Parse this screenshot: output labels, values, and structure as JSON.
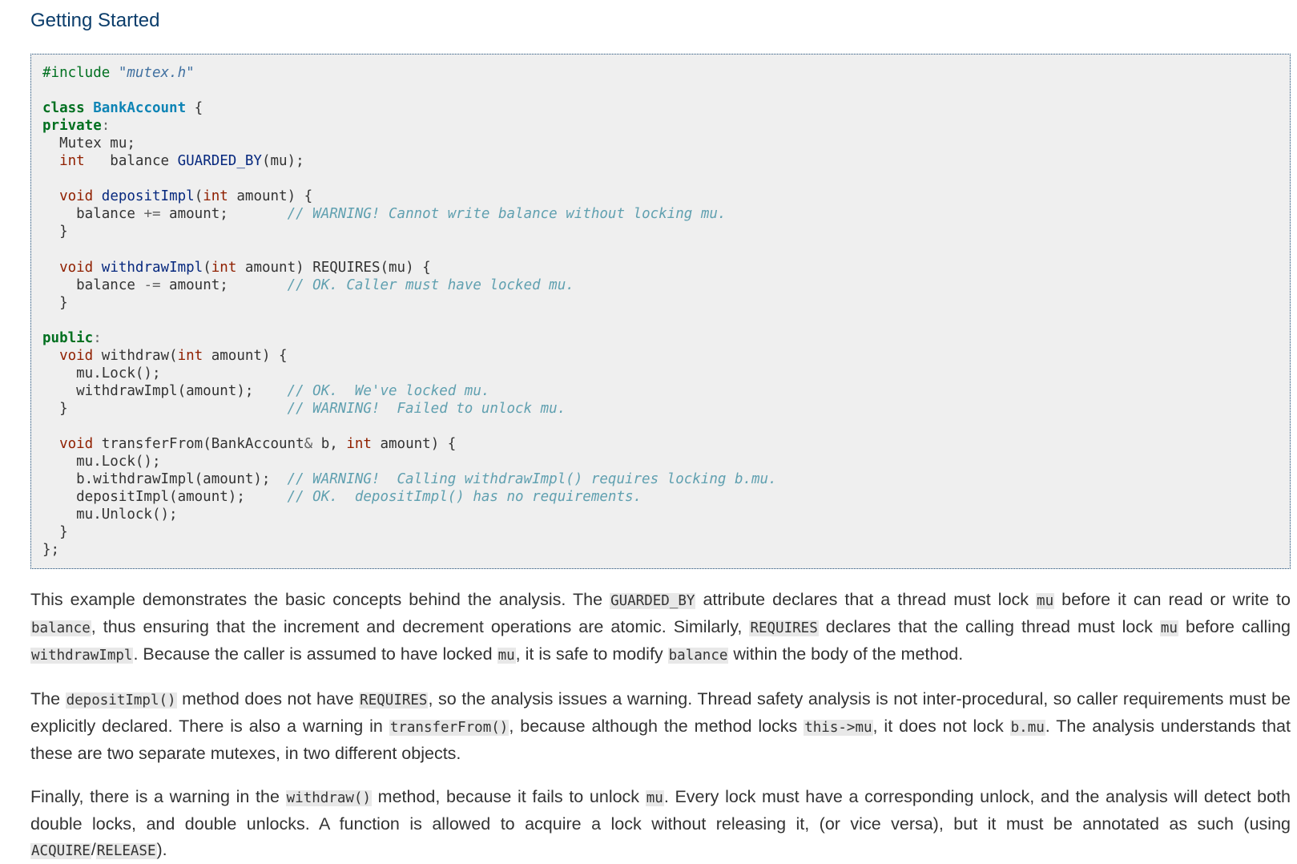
{
  "heading": "Getting Started",
  "code_lines": [
    [
      {
        "t": "#include ",
        "c": "pp"
      },
      {
        "t": "\"mutex.h\"",
        "c": "str"
      }
    ],
    [],
    [
      {
        "t": "class",
        "c": "kw"
      },
      {
        "t": " ",
        "c": "t"
      },
      {
        "t": "BankAccount",
        "c": "cls"
      },
      {
        "t": " {",
        "c": "t"
      }
    ],
    [
      {
        "t": "private",
        "c": "kw"
      },
      {
        "t": ":",
        "c": "op"
      }
    ],
    [
      {
        "t": "  Mutex mu;",
        "c": "t"
      }
    ],
    [
      {
        "t": "  ",
        "c": "t"
      },
      {
        "t": "int",
        "c": "type"
      },
      {
        "t": "   balance ",
        "c": "t"
      },
      {
        "t": "GUARDED_BY",
        "c": "mac"
      },
      {
        "t": "(mu);",
        "c": "t"
      }
    ],
    [],
    [
      {
        "t": "  ",
        "c": "t"
      },
      {
        "t": "void",
        "c": "type"
      },
      {
        "t": " ",
        "c": "t"
      },
      {
        "t": "depositImpl",
        "c": "fn"
      },
      {
        "t": "(",
        "c": "t"
      },
      {
        "t": "int",
        "c": "type"
      },
      {
        "t": " amount) {",
        "c": "t"
      }
    ],
    [
      {
        "t": "    balance ",
        "c": "t"
      },
      {
        "t": "+=",
        "c": "op"
      },
      {
        "t": " amount;       ",
        "c": "t"
      },
      {
        "t": "// WARNING! Cannot write balance without locking mu.",
        "c": "cm"
      }
    ],
    [
      {
        "t": "  }",
        "c": "t"
      }
    ],
    [],
    [
      {
        "t": "  ",
        "c": "t"
      },
      {
        "t": "void",
        "c": "type"
      },
      {
        "t": " ",
        "c": "t"
      },
      {
        "t": "withdrawImpl",
        "c": "fn"
      },
      {
        "t": "(",
        "c": "t"
      },
      {
        "t": "int",
        "c": "type"
      },
      {
        "t": " amount) REQUIRES(mu) {",
        "c": "t"
      }
    ],
    [
      {
        "t": "    balance ",
        "c": "t"
      },
      {
        "t": "-=",
        "c": "op"
      },
      {
        "t": " amount;       ",
        "c": "t"
      },
      {
        "t": "// OK. Caller must have locked mu.",
        "c": "cm"
      }
    ],
    [
      {
        "t": "  }",
        "c": "t"
      }
    ],
    [],
    [
      {
        "t": "public",
        "c": "kw"
      },
      {
        "t": ":",
        "c": "op"
      }
    ],
    [
      {
        "t": "  ",
        "c": "t"
      },
      {
        "t": "void",
        "c": "type"
      },
      {
        "t": " withdraw(",
        "c": "t"
      },
      {
        "t": "int",
        "c": "type"
      },
      {
        "t": " amount) {",
        "c": "t"
      }
    ],
    [
      {
        "t": "    mu.Lock();",
        "c": "t"
      }
    ],
    [
      {
        "t": "    withdrawImpl(amount);    ",
        "c": "t"
      },
      {
        "t": "// OK.  We've locked mu.",
        "c": "cm"
      }
    ],
    [
      {
        "t": "  }                          ",
        "c": "t"
      },
      {
        "t": "// WARNING!  Failed to unlock mu.",
        "c": "cm"
      }
    ],
    [],
    [
      {
        "t": "  ",
        "c": "t"
      },
      {
        "t": "void",
        "c": "type"
      },
      {
        "t": " transferFrom(BankAccount",
        "c": "t"
      },
      {
        "t": "&",
        "c": "op"
      },
      {
        "t": " b, ",
        "c": "t"
      },
      {
        "t": "int",
        "c": "type"
      },
      {
        "t": " amount) {",
        "c": "t"
      }
    ],
    [
      {
        "t": "    mu.Lock();",
        "c": "t"
      }
    ],
    [
      {
        "t": "    b.withdrawImpl(amount);  ",
        "c": "t"
      },
      {
        "t": "// WARNING!  Calling withdrawImpl() requires locking b.mu.",
        "c": "cm"
      }
    ],
    [
      {
        "t": "    depositImpl(amount);     ",
        "c": "t"
      },
      {
        "t": "// OK.  depositImpl() has no requirements.",
        "c": "cm"
      }
    ],
    [
      {
        "t": "    mu.Unlock();",
        "c": "t"
      }
    ],
    [
      {
        "t": "  }",
        "c": "t"
      }
    ],
    [
      {
        "t": "};",
        "c": "t"
      }
    ]
  ],
  "paragraphs": [
    [
      {
        "t": "This example demonstrates the basic concepts behind the analysis. The "
      },
      {
        "t": "GUARDED_BY",
        "code": true
      },
      {
        "t": " attribute declares that a thread must lock "
      },
      {
        "t": "mu",
        "code": true
      },
      {
        "t": " before it can read or write to "
      },
      {
        "t": "balance",
        "code": true
      },
      {
        "t": ", thus ensuring that the increment and decrement operations are atomic. Similarly, "
      },
      {
        "t": "REQUIRES",
        "code": true
      },
      {
        "t": " declares that the calling thread must lock "
      },
      {
        "t": "mu",
        "code": true
      },
      {
        "t": " before calling "
      },
      {
        "t": "withdrawImpl",
        "code": true
      },
      {
        "t": ". Because the caller is assumed to have locked "
      },
      {
        "t": "mu",
        "code": true
      },
      {
        "t": ", it is safe to modify "
      },
      {
        "t": "balance",
        "code": true
      },
      {
        "t": " within the body of the method."
      }
    ],
    [
      {
        "t": "The "
      },
      {
        "t": "depositImpl()",
        "code": true
      },
      {
        "t": " method does not have "
      },
      {
        "t": "REQUIRES",
        "code": true
      },
      {
        "t": ", so the analysis issues a warning. Thread safety analysis is not inter-procedural, so caller requirements must be explicitly declared. There is also a warning in "
      },
      {
        "t": "transferFrom()",
        "code": true
      },
      {
        "t": ", because although the method locks "
      },
      {
        "t": "this->mu",
        "code": true
      },
      {
        "t": ", it does not lock "
      },
      {
        "t": "b.mu",
        "code": true
      },
      {
        "t": ". The analysis understands that these are two separate mutexes, in two different objects."
      }
    ],
    [
      {
        "t": "Finally, there is a warning in the "
      },
      {
        "t": "withdraw()",
        "code": true
      },
      {
        "t": " method, because it fails to unlock "
      },
      {
        "t": "mu",
        "code": true
      },
      {
        "t": ". Every lock must have a corresponding unlock, and the analysis will detect both double locks, and double unlocks. A function is allowed to acquire a lock without releasing it, (or vice versa), but it must be annotated as such (using "
      },
      {
        "t": "ACQUIRE",
        "code": true
      },
      {
        "t": "/"
      },
      {
        "t": "RELEASE",
        "code": true
      },
      {
        "t": ")."
      }
    ]
  ]
}
